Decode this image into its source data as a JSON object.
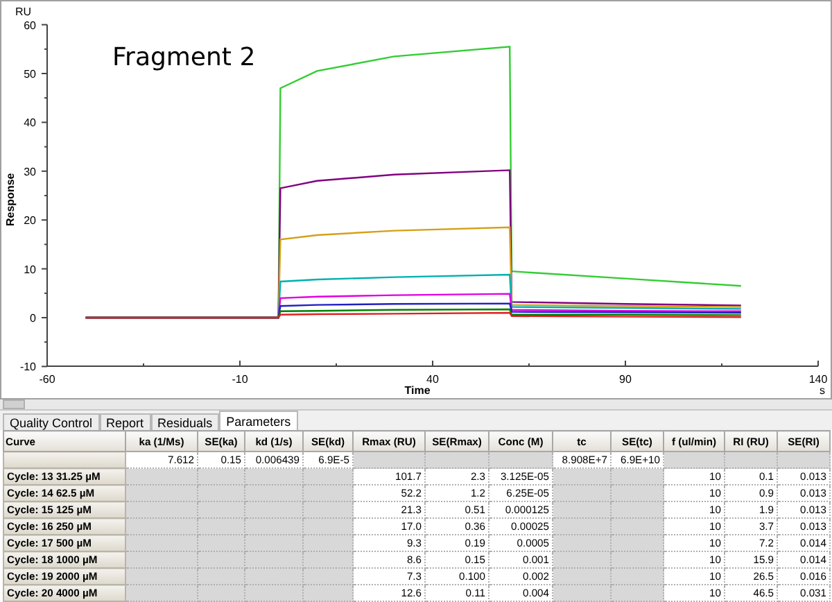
{
  "chart": {
    "chart_data": {
      "type": "line",
      "title": "Fragment 2",
      "xlabel": "Time",
      "ylabel": "Response",
      "x": [
        -50,
        0,
        0.5,
        10,
        30,
        60,
        60.5,
        90,
        120
      ],
      "xlim": [
        -60,
        140
      ],
      "ylim": [
        -10,
        60
      ],
      "xticks": [
        -60,
        -10,
        40,
        90,
        140
      ],
      "yticks": [
        -10,
        0,
        10,
        20,
        30,
        40,
        50,
        60
      ],
      "series": [
        {
          "color": "#33cc33",
          "values": [
            0,
            0,
            47,
            50.5,
            53.5,
            55.5,
            9.5,
            8,
            6.5
          ]
        },
        {
          "color": "#800080",
          "values": [
            0,
            0,
            26.5,
            28,
            29.3,
            30.2,
            3.2,
            2.8,
            2.5
          ]
        },
        {
          "color": "#d4a017",
          "values": [
            0,
            0,
            16,
            16.9,
            17.8,
            18.5,
            2.6,
            2.4,
            2.2
          ]
        },
        {
          "color": "#00b0b0",
          "values": [
            0,
            0,
            7.4,
            7.8,
            8.3,
            8.8,
            2.2,
            2,
            1.8
          ]
        },
        {
          "color": "#e000e0",
          "values": [
            0,
            0,
            4,
            4.3,
            4.6,
            4.9,
            1.6,
            1.4,
            1.3
          ]
        },
        {
          "color": "#2020c0",
          "values": [
            0,
            0,
            2.4,
            2.6,
            2.8,
            2.9,
            1.2,
            1.1,
            1
          ]
        },
        {
          "color": "#008000",
          "values": [
            0,
            0,
            1.3,
            1.4,
            1.6,
            1.7,
            0.6,
            0.6,
            0.5
          ]
        },
        {
          "color": "#e02020",
          "values": [
            0,
            0,
            0.6,
            0.7,
            0.8,
            1,
            0.3,
            0.2,
            0.1
          ]
        }
      ]
    },
    "y_unit": "RU",
    "x_unit": "s"
  },
  "tabs": [
    {
      "label": "Quality Control",
      "selected": false
    },
    {
      "label": "Report",
      "selected": false
    },
    {
      "label": "Residuals",
      "selected": false
    },
    {
      "label": "Parameters",
      "selected": true
    }
  ],
  "table": {
    "columns": [
      "Curve",
      "ka (1/Ms)",
      "SE(ka)",
      "kd (1/s)",
      "SE(kd)",
      "Rmax (RU)",
      "SE(Rmax)",
      "Conc (M)",
      "tc",
      "SE(tc)",
      "f (ul/min)",
      "RI (RU)",
      "SE(RI)"
    ],
    "rows": [
      [
        null,
        "7.612",
        "0.15",
        "0.006439",
        "6.9E-5",
        null,
        null,
        null,
        "8.908E+7",
        "6.9E+10",
        null,
        null,
        null
      ],
      [
        "Cycle: 13  31.25 µM",
        null,
        null,
        null,
        null,
        "101.7",
        "2.3",
        "3.125E-05",
        null,
        null,
        "10",
        "0.1",
        "0.013"
      ],
      [
        "Cycle: 14  62.5 µM",
        null,
        null,
        null,
        null,
        "52.2",
        "1.2",
        "6.25E-05",
        null,
        null,
        "10",
        "0.9",
        "0.013"
      ],
      [
        "Cycle: 15  125 µM",
        null,
        null,
        null,
        null,
        "21.3",
        "0.51",
        "0.000125",
        null,
        null,
        "10",
        "1.9",
        "0.013"
      ],
      [
        "Cycle: 16  250 µM",
        null,
        null,
        null,
        null,
        "17.0",
        "0.36",
        "0.00025",
        null,
        null,
        "10",
        "3.7",
        "0.013"
      ],
      [
        "Cycle: 17  500 µM",
        null,
        null,
        null,
        null,
        "9.3",
        "0.19",
        "0.0005",
        null,
        null,
        "10",
        "7.2",
        "0.014"
      ],
      [
        "Cycle: 18  1000 µM",
        null,
        null,
        null,
        null,
        "8.6",
        "0.15",
        "0.001",
        null,
        null,
        "10",
        "15.9",
        "0.014"
      ],
      [
        "Cycle: 19  2000 µM",
        null,
        null,
        null,
        null,
        "7.3",
        "0.100",
        "0.002",
        null,
        null,
        "10",
        "26.5",
        "0.016"
      ],
      [
        "Cycle: 20  4000 µM",
        null,
        null,
        null,
        null,
        "12.6",
        "0.11",
        "0.004",
        null,
        null,
        "10",
        "46.5",
        "0.031"
      ]
    ]
  }
}
